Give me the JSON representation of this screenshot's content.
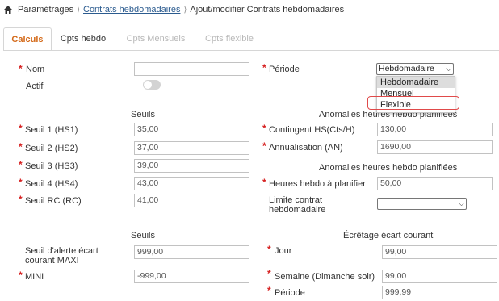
{
  "breadcrumb": {
    "root": "Paramétrages",
    "link": "Contrats hebdomadaires",
    "current": "Ajout/modifier Contrats hebdomadaires"
  },
  "tabs": [
    {
      "label": "Calculs",
      "state": "active"
    },
    {
      "label": "Cpts hebdo",
      "state": "normal"
    },
    {
      "label": "Cpts Mensuels",
      "state": "disabled"
    },
    {
      "label": "Cpts flexible",
      "state": "disabled"
    }
  ],
  "left": {
    "nom": {
      "label": "Nom",
      "value": ""
    },
    "actif": {
      "label": "Actif",
      "on": false
    },
    "seuils_header": "Seuils",
    "seuil1": {
      "label": "Seuil 1 (HS1)",
      "value": "35,00"
    },
    "seuil2": {
      "label": "Seuil 2 (HS2)",
      "value": "37,00"
    },
    "seuil3": {
      "label": "Seuil 3 (HS3)",
      "value": "39,00"
    },
    "seuil4": {
      "label": "Seuil 4 (HS4)",
      "value": "43,00"
    },
    "seuilrc": {
      "label": "Seuil RC (RC)",
      "value": "41,00"
    },
    "seuils2_header": "Seuils",
    "alerte": {
      "label": "Seuil d'alerte écart courant MAXI",
      "value": "999,00"
    },
    "mini": {
      "label": "MINI",
      "value": "-999,00"
    }
  },
  "right": {
    "periode": {
      "label": "Période",
      "selected": "Hebdomadaire"
    },
    "periode_options": [
      "Hebdomadaire",
      "Mensuel",
      "Flexible"
    ],
    "anomalies_header": "Anomalies heures hebdo planifiées",
    "contingent": {
      "label": "Contingent HS(Cts/H)",
      "value": "130,00"
    },
    "annualisation": {
      "label": "Annualisation (AN)",
      "value": "1690,00"
    },
    "anomalies2_header": "Anomalies heures hebdo planifiées",
    "heures": {
      "label": "Heures hebdo à planifier",
      "value": "50,00"
    },
    "limite": {
      "label": "Limite contrat hebdomadaire",
      "value": ""
    },
    "ecretage_header": "Écrêtage écart courant",
    "jour": {
      "label": "Jour",
      "value": "99,00"
    },
    "semaine": {
      "label": "Semaine (Dimanche soir)",
      "value": "99,00"
    },
    "periode2": {
      "label": "Période",
      "value": "999,99"
    }
  },
  "icons": {
    "home": "home-icon",
    "chevron": "chevron-right-icon",
    "caret": "caret-down-icon"
  },
  "colors": {
    "accent": "#d46a1a",
    "required": "#d62020",
    "link": "#2b5b8f",
    "highlight_box": "#e04a4a"
  }
}
